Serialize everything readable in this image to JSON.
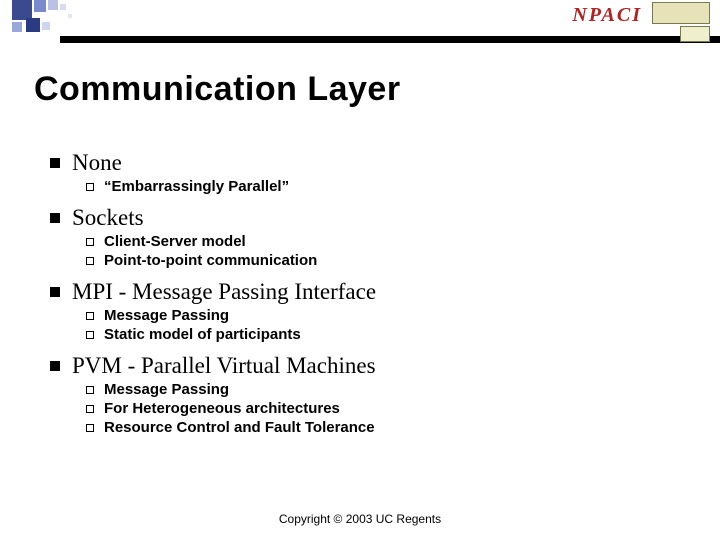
{
  "logo": "NPACI",
  "title": "Communication Layer",
  "sections": [
    {
      "heading": "None",
      "items": [
        "“Embarrassingly Parallel”"
      ]
    },
    {
      "heading": "Sockets",
      "items": [
        "Client-Server model",
        "Point-to-point communication"
      ]
    },
    {
      "heading": "MPI - Message Passing Interface",
      "items": [
        "Message Passing",
        "Static model of participants"
      ]
    },
    {
      "heading": "PVM - Parallel Virtual Machines",
      "items": [
        "Message Passing",
        "For Heterogeneous architectures",
        "Resource Control and Fault Tolerance"
      ]
    }
  ],
  "footer": "Copyright © 2003 UC Regents"
}
